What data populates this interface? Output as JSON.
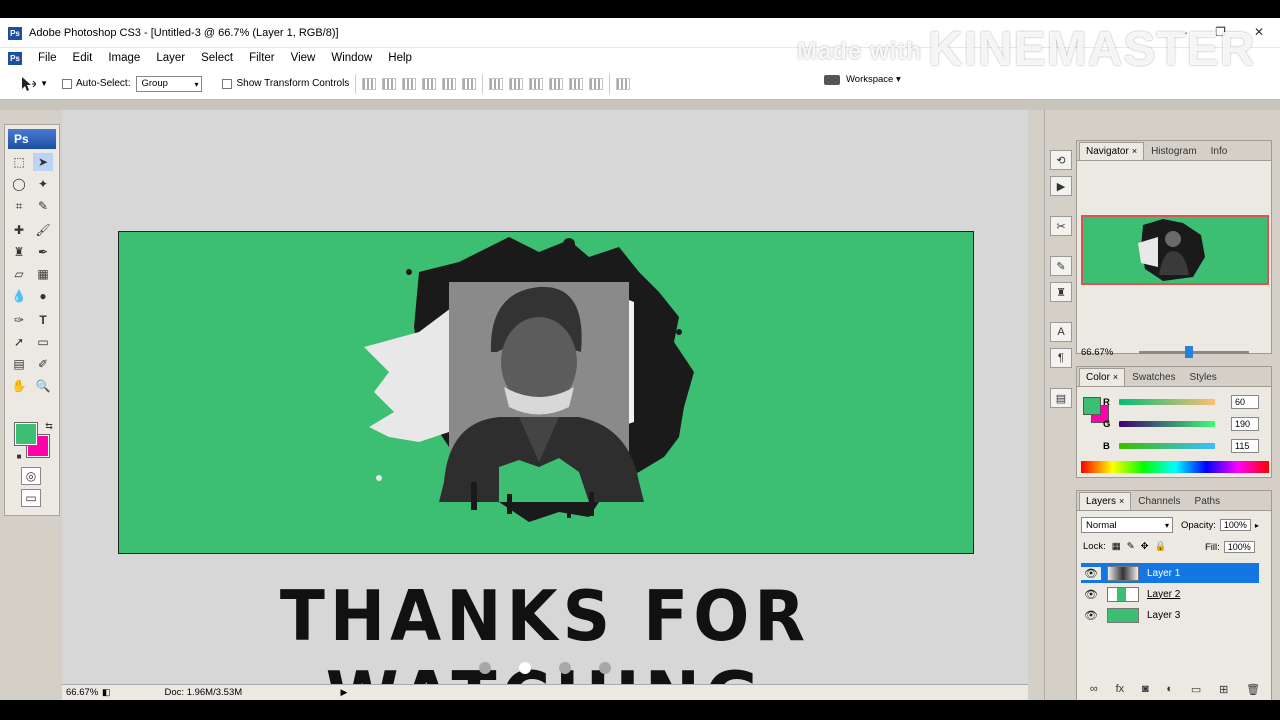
{
  "window": {
    "title": "Adobe Photoshop CS3 - [Untitled-3 @ 66.7% (Layer 1, RGB/8)]",
    "controls": [
      "–",
      "❐",
      "✕"
    ]
  },
  "menu": [
    "File",
    "Edit",
    "Image",
    "Layer",
    "Select",
    "Filter",
    "View",
    "Window",
    "Help"
  ],
  "options": {
    "auto_select_label": "Auto-Select:",
    "auto_select_value": "Group",
    "show_transform_label": "Show Transform Controls",
    "workspace_label": "Workspace ▾"
  },
  "watermark": {
    "small": "Made with",
    "big": "KINEMASTER"
  },
  "toolbox": {
    "logo": "Ps"
  },
  "canvas": {
    "caption": "THANKS FOR WATCHING",
    "bg_color": "#3cbe73"
  },
  "status": {
    "zoom": "66.67%",
    "doc": "Doc: 1.96M/3.53M"
  },
  "navigator": {
    "tabs": [
      "Navigator",
      "Histogram",
      "Info"
    ],
    "zoom": "66.67%"
  },
  "color_panel": {
    "tabs": [
      "Color",
      "Swatches",
      "Styles"
    ],
    "r": {
      "label": "R",
      "value": "60"
    },
    "g": {
      "label": "G",
      "value": "190"
    },
    "b": {
      "label": "B",
      "value": "115"
    },
    "foreground": "#3cbe73",
    "background": "#ff00aa"
  },
  "layers_panel": {
    "tabs": [
      "Layers",
      "Channels",
      "Paths"
    ],
    "blend_mode": "Normal",
    "opacity_label": "Opacity:",
    "opacity_value": "100%",
    "lock_label": "Lock:",
    "fill_label": "Fill:",
    "fill_value": "100%",
    "layers": [
      "Layer 1",
      "Layer 2",
      "Layer 3"
    ]
  },
  "pager": {
    "count": 4,
    "active_index": 1
  }
}
